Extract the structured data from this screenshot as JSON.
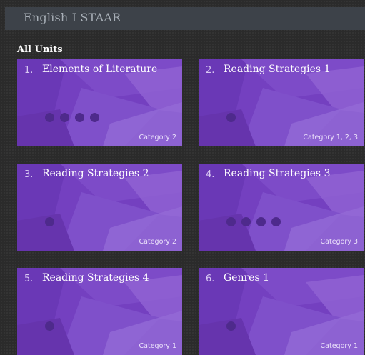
{
  "header": {
    "title": "English I STAAR"
  },
  "section": {
    "title": "All Units"
  },
  "units": [
    {
      "number": "1.",
      "title": "Elements of Literature",
      "category": "Category 2",
      "dots": 4
    },
    {
      "number": "2.",
      "title": "Reading Strategies 1",
      "category": "Category 1, 2, 3",
      "dots": 1
    },
    {
      "number": "3.",
      "title": "Reading Strategies 2",
      "category": "Category 2",
      "dots": 1
    },
    {
      "number": "4.",
      "title": "Reading Strategies 3",
      "category": "Category 3",
      "dots": 4
    },
    {
      "number": "5.",
      "title": "Reading Strategies 4",
      "category": "Category 1",
      "dots": 1
    },
    {
      "number": "6.",
      "title": "Genres 1",
      "category": "Category 1",
      "dots": 1
    }
  ],
  "colors": {
    "card_base": "#7440c0",
    "dot": "#4e2a8c",
    "header_bg": "#3d4249"
  }
}
